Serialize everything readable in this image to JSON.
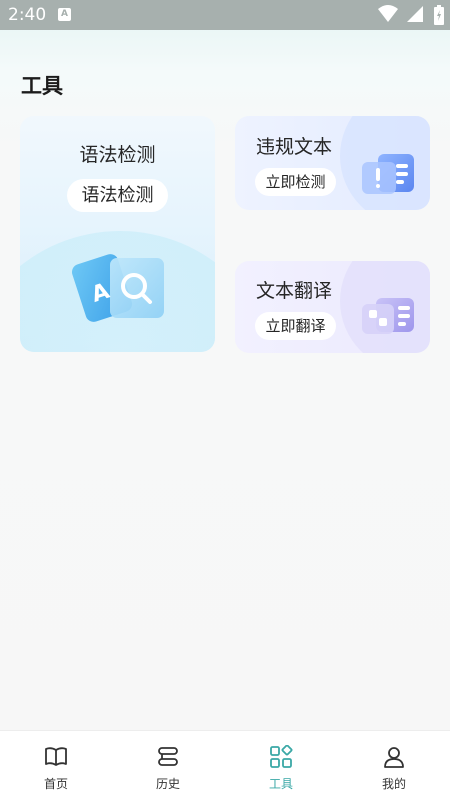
{
  "status_bar": {
    "time": "2:40",
    "app_icon_letter": "A"
  },
  "page": {
    "title": "工具"
  },
  "tools": {
    "grammar": {
      "title": "语法检测",
      "action": "语法检测"
    },
    "violation": {
      "title": "违规文本",
      "action": "立即检测"
    },
    "translate": {
      "title": "文本翻译",
      "action": "立即翻译"
    }
  },
  "bottom_nav": {
    "items": [
      {
        "label": "首页",
        "icon": "book-icon"
      },
      {
        "label": "历史",
        "icon": "history-icon"
      },
      {
        "label": "工具",
        "icon": "tools-grid-icon",
        "active": true
      },
      {
        "label": "我的",
        "icon": "profile-icon"
      }
    ],
    "active_color": "#3aa8a6"
  },
  "colors": {
    "accent": "#3aa8a6",
    "status_bar": "#a7b0ae"
  }
}
